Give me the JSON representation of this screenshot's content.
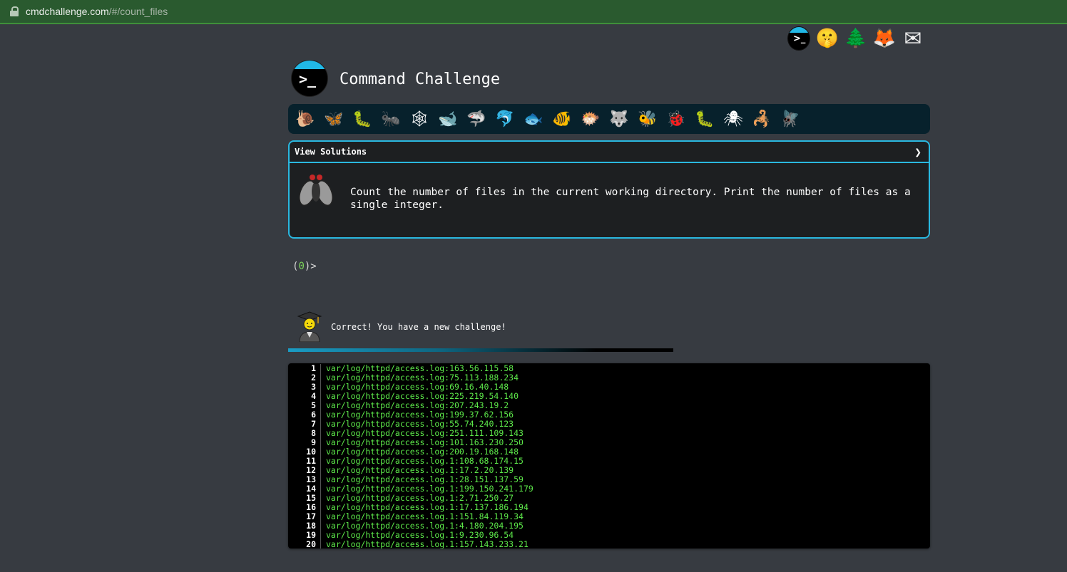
{
  "browser": {
    "url_domain": "cmdchallenge.com",
    "url_path": "/#/count_files"
  },
  "top_icons": [
    {
      "name": "terminal-logo-icon",
      "glyph": ""
    },
    {
      "name": "shushing-face-icon",
      "glyph": "🤫"
    },
    {
      "name": "tree-icon",
      "glyph": "🌲"
    },
    {
      "name": "gitlab-icon",
      "glyph": "🦊"
    },
    {
      "name": "mail-icon",
      "glyph": "✉"
    }
  ],
  "header": {
    "title": "Command Challenge"
  },
  "animals": [
    {
      "name": "snail",
      "glyph": "🐌"
    },
    {
      "name": "butterfly",
      "glyph": "🦋"
    },
    {
      "name": "caterpillar",
      "glyph": "🐛"
    },
    {
      "name": "ant",
      "glyph": "🐜"
    },
    {
      "name": "spider-web",
      "glyph": "🕸"
    },
    {
      "name": "whale",
      "glyph": "🐋"
    },
    {
      "name": "shark",
      "glyph": "🦈"
    },
    {
      "name": "dolphin",
      "glyph": "🐬"
    },
    {
      "name": "fish",
      "glyph": "🐟"
    },
    {
      "name": "tropical-fish",
      "glyph": "🐠"
    },
    {
      "name": "blowfish",
      "glyph": "🐡"
    },
    {
      "name": "wolf",
      "glyph": "🐺"
    },
    {
      "name": "bee",
      "glyph": "🐝"
    },
    {
      "name": "ladybug",
      "glyph": "🐞"
    },
    {
      "name": "worm",
      "glyph": "🐛"
    },
    {
      "name": "spider",
      "glyph": "🕷"
    },
    {
      "name": "scorpion",
      "glyph": "🦂"
    },
    {
      "name": "fly",
      "glyph": "🪰"
    }
  ],
  "challenge": {
    "view_solutions_label": "View Solutions",
    "chevron": "❯",
    "description": "Count the number of files in the current working directory. Print the number of files as a single integer."
  },
  "prompt": {
    "open": "(",
    "count": "0",
    "close": ")>"
  },
  "result": {
    "message": "Correct! You have a new challenge!"
  },
  "output_lines": [
    {
      "n": "1",
      "text": "var/log/httpd/access.log:163.56.115.58"
    },
    {
      "n": "2",
      "text": "var/log/httpd/access.log:75.113.188.234"
    },
    {
      "n": "3",
      "text": "var/log/httpd/access.log:69.16.40.148"
    },
    {
      "n": "4",
      "text": "var/log/httpd/access.log:225.219.54.140"
    },
    {
      "n": "5",
      "text": "var/log/httpd/access.log:207.243.19.2"
    },
    {
      "n": "6",
      "text": "var/log/httpd/access.log:199.37.62.156"
    },
    {
      "n": "7",
      "text": "var/log/httpd/access.log:55.74.240.123"
    },
    {
      "n": "8",
      "text": "var/log/httpd/access.log:251.111.109.143"
    },
    {
      "n": "9",
      "text": "var/log/httpd/access.log:101.163.230.250"
    },
    {
      "n": "10",
      "text": "var/log/httpd/access.log:200.19.168.148"
    },
    {
      "n": "11",
      "text": "var/log/httpd/access.log.1:108.68.174.15"
    },
    {
      "n": "12",
      "text": "var/log/httpd/access.log.1:17.2.20.139"
    },
    {
      "n": "13",
      "text": "var/log/httpd/access.log.1:28.151.137.59"
    },
    {
      "n": "14",
      "text": "var/log/httpd/access.log.1:199.150.241.179"
    },
    {
      "n": "15",
      "text": "var/log/httpd/access.log.1:2.71.250.27"
    },
    {
      "n": "16",
      "text": "var/log/httpd/access.log.1:17.137.186.194"
    },
    {
      "n": "17",
      "text": "var/log/httpd/access.log.1:151.84.119.34"
    },
    {
      "n": "18",
      "text": "var/log/httpd/access.log.1:4.180.204.195"
    },
    {
      "n": "19",
      "text": "var/log/httpd/access.log.1:9.230.96.54"
    },
    {
      "n": "20",
      "text": "var/log/httpd/access.log.1:157.143.233.21"
    }
  ]
}
